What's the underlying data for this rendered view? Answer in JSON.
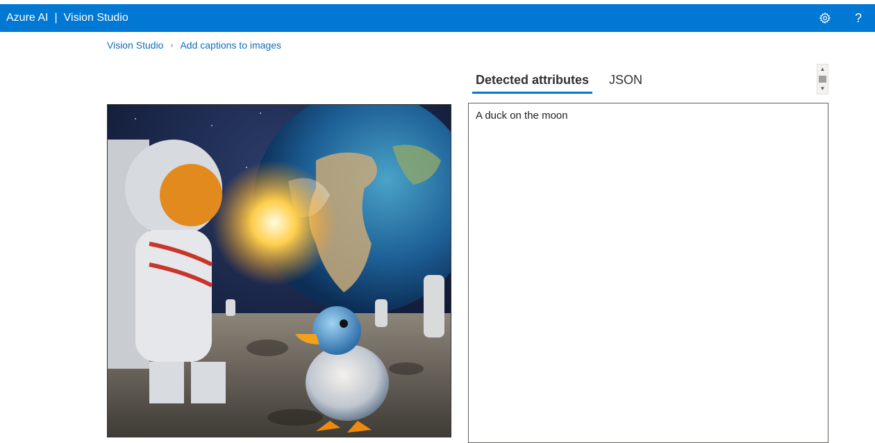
{
  "app": {
    "brand": "Azure AI",
    "separator": "|",
    "product": "Vision Studio"
  },
  "topbar_icons": [
    "gear-icon",
    "help-icon"
  ],
  "breadcrumb": {
    "home": "Vision Studio",
    "current": "Add captions to images"
  },
  "tabs": [
    {
      "label": "Detected attributes",
      "active": true
    },
    {
      "label": "JSON",
      "active": false
    }
  ],
  "result": {
    "caption": "A duck on the moon"
  },
  "image": {
    "subject": "astronaut and duck on the moon with Earth in the sky"
  },
  "colors": {
    "accent": "#0078d4",
    "link": "#0f6cbd"
  }
}
